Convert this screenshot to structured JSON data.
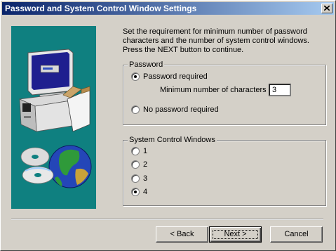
{
  "window": {
    "title": "Password and System Control Window Settings"
  },
  "instructions": "Set the requirement for minimum number of password characters and the number of system control windows. Press the NEXT button to continue.",
  "password_group": {
    "legend": "Password",
    "options": [
      {
        "label": "Password required",
        "checked": true
      },
      {
        "label": "No password required",
        "checked": false
      }
    ],
    "min_chars_label": "Minimum number of characters",
    "min_chars_value": "3"
  },
  "scw_group": {
    "legend": "System Control Windows",
    "options": [
      {
        "label": "1",
        "checked": false
      },
      {
        "label": "2",
        "checked": false
      },
      {
        "label": "3",
        "checked": false
      },
      {
        "label": "4",
        "checked": true
      }
    ]
  },
  "buttons": {
    "back": "< Back",
    "next": "Next >",
    "cancel": "Cancel"
  },
  "colors": {
    "title_gradient_start": "#0a246a",
    "title_gradient_end": "#a6caf0",
    "dialog_face": "#d4d0c8",
    "art_background": "#0f8080"
  },
  "icons": {
    "close": "close-icon",
    "illustration": "computer-globe-illustration"
  }
}
